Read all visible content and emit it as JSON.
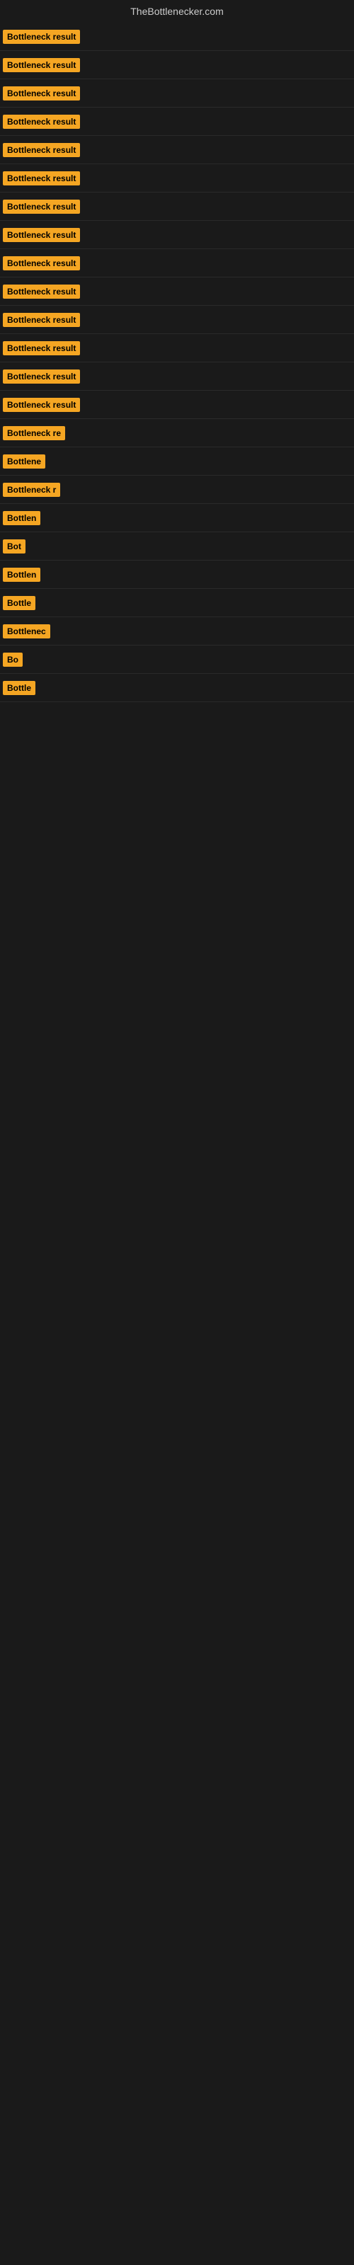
{
  "site": {
    "title": "TheBottlenecker.com"
  },
  "results": [
    {
      "id": 1,
      "label": "Bottleneck result",
      "width": 130
    },
    {
      "id": 2,
      "label": "Bottleneck result",
      "width": 130
    },
    {
      "id": 3,
      "label": "Bottleneck result",
      "width": 130
    },
    {
      "id": 4,
      "label": "Bottleneck result",
      "width": 130
    },
    {
      "id": 5,
      "label": "Bottleneck result",
      "width": 130
    },
    {
      "id": 6,
      "label": "Bottleneck result",
      "width": 130
    },
    {
      "id": 7,
      "label": "Bottleneck result",
      "width": 130
    },
    {
      "id": 8,
      "label": "Bottleneck result",
      "width": 130
    },
    {
      "id": 9,
      "label": "Bottleneck result",
      "width": 130
    },
    {
      "id": 10,
      "label": "Bottleneck result",
      "width": 130
    },
    {
      "id": 11,
      "label": "Bottleneck result",
      "width": 130
    },
    {
      "id": 12,
      "label": "Bottleneck result",
      "width": 130
    },
    {
      "id": 13,
      "label": "Bottleneck result",
      "width": 130
    },
    {
      "id": 14,
      "label": "Bottleneck result",
      "width": 130
    },
    {
      "id": 15,
      "label": "Bottleneck re",
      "width": 100
    },
    {
      "id": 16,
      "label": "Bottlene",
      "width": 75
    },
    {
      "id": 17,
      "label": "Bottleneck r",
      "width": 90
    },
    {
      "id": 18,
      "label": "Bottlen",
      "width": 65
    },
    {
      "id": 19,
      "label": "Bot",
      "width": 38
    },
    {
      "id": 20,
      "label": "Bottlen",
      "width": 65
    },
    {
      "id": 21,
      "label": "Bottle",
      "width": 55
    },
    {
      "id": 22,
      "label": "Bottlenec",
      "width": 80
    },
    {
      "id": 23,
      "label": "Bo",
      "width": 28
    },
    {
      "id": 24,
      "label": "Bottle",
      "width": 55
    }
  ]
}
